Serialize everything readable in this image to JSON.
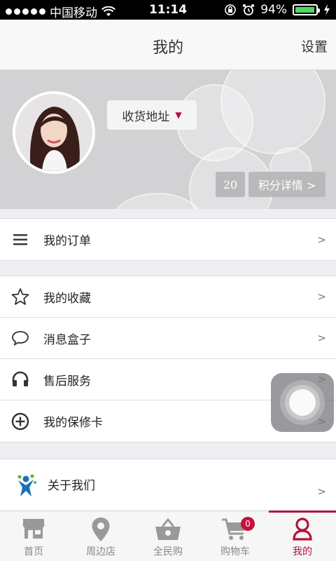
{
  "status_bar": {
    "carrier": "中国移动",
    "time": "11:14",
    "battery_percent": "94%",
    "battery_level": 0.94
  },
  "nav": {
    "title": "我的",
    "settings": "设置"
  },
  "profile": {
    "address_button": "收货地址",
    "points": "20",
    "points_detail": "积分详情 >"
  },
  "menu": {
    "orders": {
      "label": "我的订单",
      "arrow": ">"
    },
    "favorites": {
      "label": "我的收藏",
      "arrow": ">"
    },
    "messages": {
      "label": "消息盒子",
      "arrow": ">"
    },
    "after_sales": {
      "label": "售后服务",
      "arrow": ">"
    },
    "warranty": {
      "label": "我的保修卡",
      "arrow": ">"
    },
    "about": {
      "label": "关于我们",
      "arrow": ">"
    }
  },
  "tabs": [
    {
      "label": "首页",
      "icon": "store-icon"
    },
    {
      "label": "周边店",
      "icon": "location-pin-icon"
    },
    {
      "label": "全民购",
      "icon": "basket-icon"
    },
    {
      "label": "购物车",
      "icon": "cart-icon",
      "badge": "0"
    },
    {
      "label": "我的",
      "icon": "person-icon",
      "active": true
    }
  ],
  "colors": {
    "accent": "#b3123a",
    "badge": "#c8103a",
    "battery": "#4cd964"
  }
}
